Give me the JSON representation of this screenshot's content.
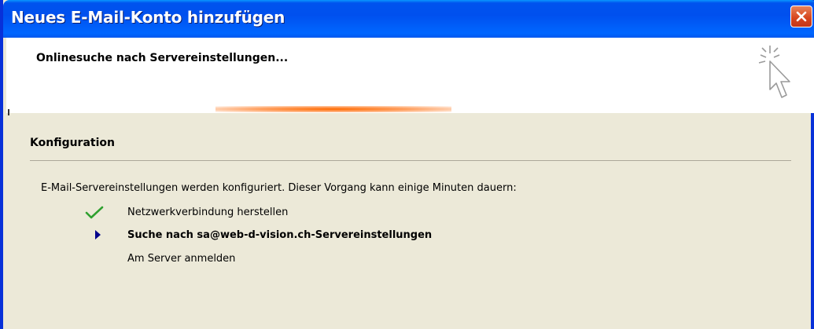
{
  "window": {
    "title": "Neues E-Mail-Konto hinzufügen"
  },
  "header": {
    "heading": "Onlinesuche nach Servereinstellungen..."
  },
  "section": {
    "title": "Konfiguration",
    "description": "E-Mail-Servereinstellungen werden konfiguriert. Dieser Vorgang kann einige Minuten dauern:"
  },
  "steps": [
    {
      "label": "Netzwerkverbindung herstellen",
      "status": "done",
      "icon": "checkmark-icon"
    },
    {
      "label": "Suche nach sa@web-d-vision.ch-Servereinstellungen",
      "status": "current",
      "icon": "arrow-right-icon"
    },
    {
      "label": "Am Server anmelden",
      "status": "pending",
      "icon": ""
    }
  ],
  "colors": {
    "titlebar": "#0058ee",
    "panel": "#ece9d8",
    "check": "#2fa02f",
    "pointer": "#00008b",
    "progress": "#ff6a00"
  }
}
